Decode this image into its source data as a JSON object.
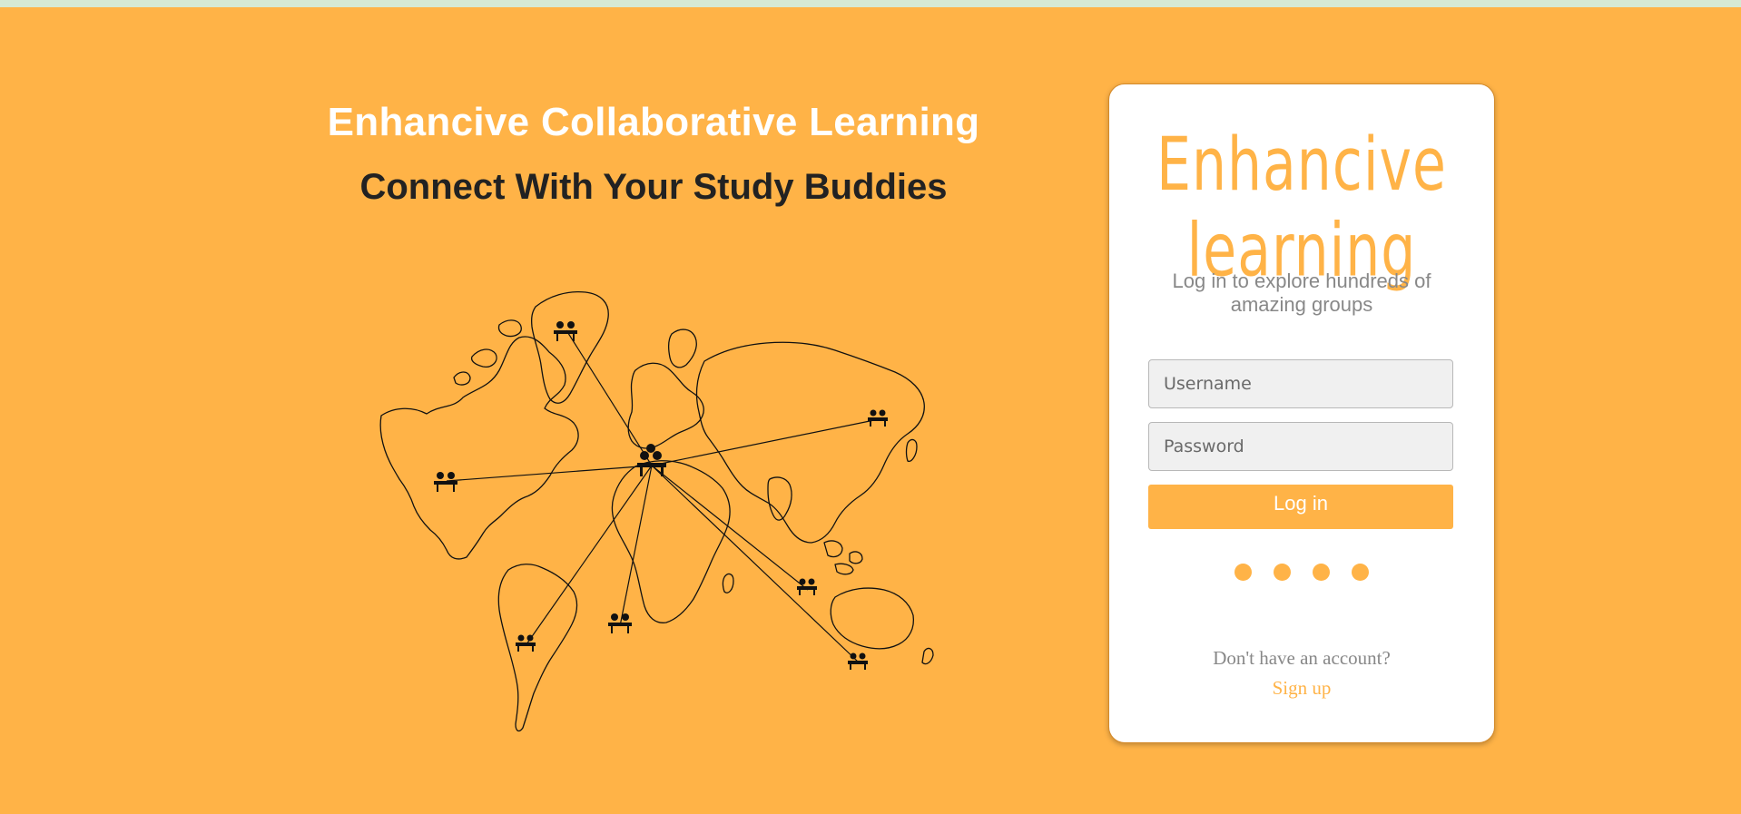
{
  "hero": {
    "headline": "Enhancive Collaborative Learning",
    "subheadline": "Connect With Your Study Buddies",
    "map_icon": "world-map-study-groups-illustration",
    "background_color": "#ffb347",
    "headline_color": "#ffffff",
    "subheadline_color": "#222222"
  },
  "login_card": {
    "brand": "Enhancive learning",
    "tagline": "Log in to explore hundreds of amazing groups",
    "username_placeholder": "Username",
    "password_placeholder": "Password",
    "login_label": "Log in",
    "no_account_text": "Don't have an account?",
    "signup_label": "Sign up",
    "loading_dots_count": 4,
    "accent_color": "#ffb347",
    "muted_text_color": "#888888"
  }
}
